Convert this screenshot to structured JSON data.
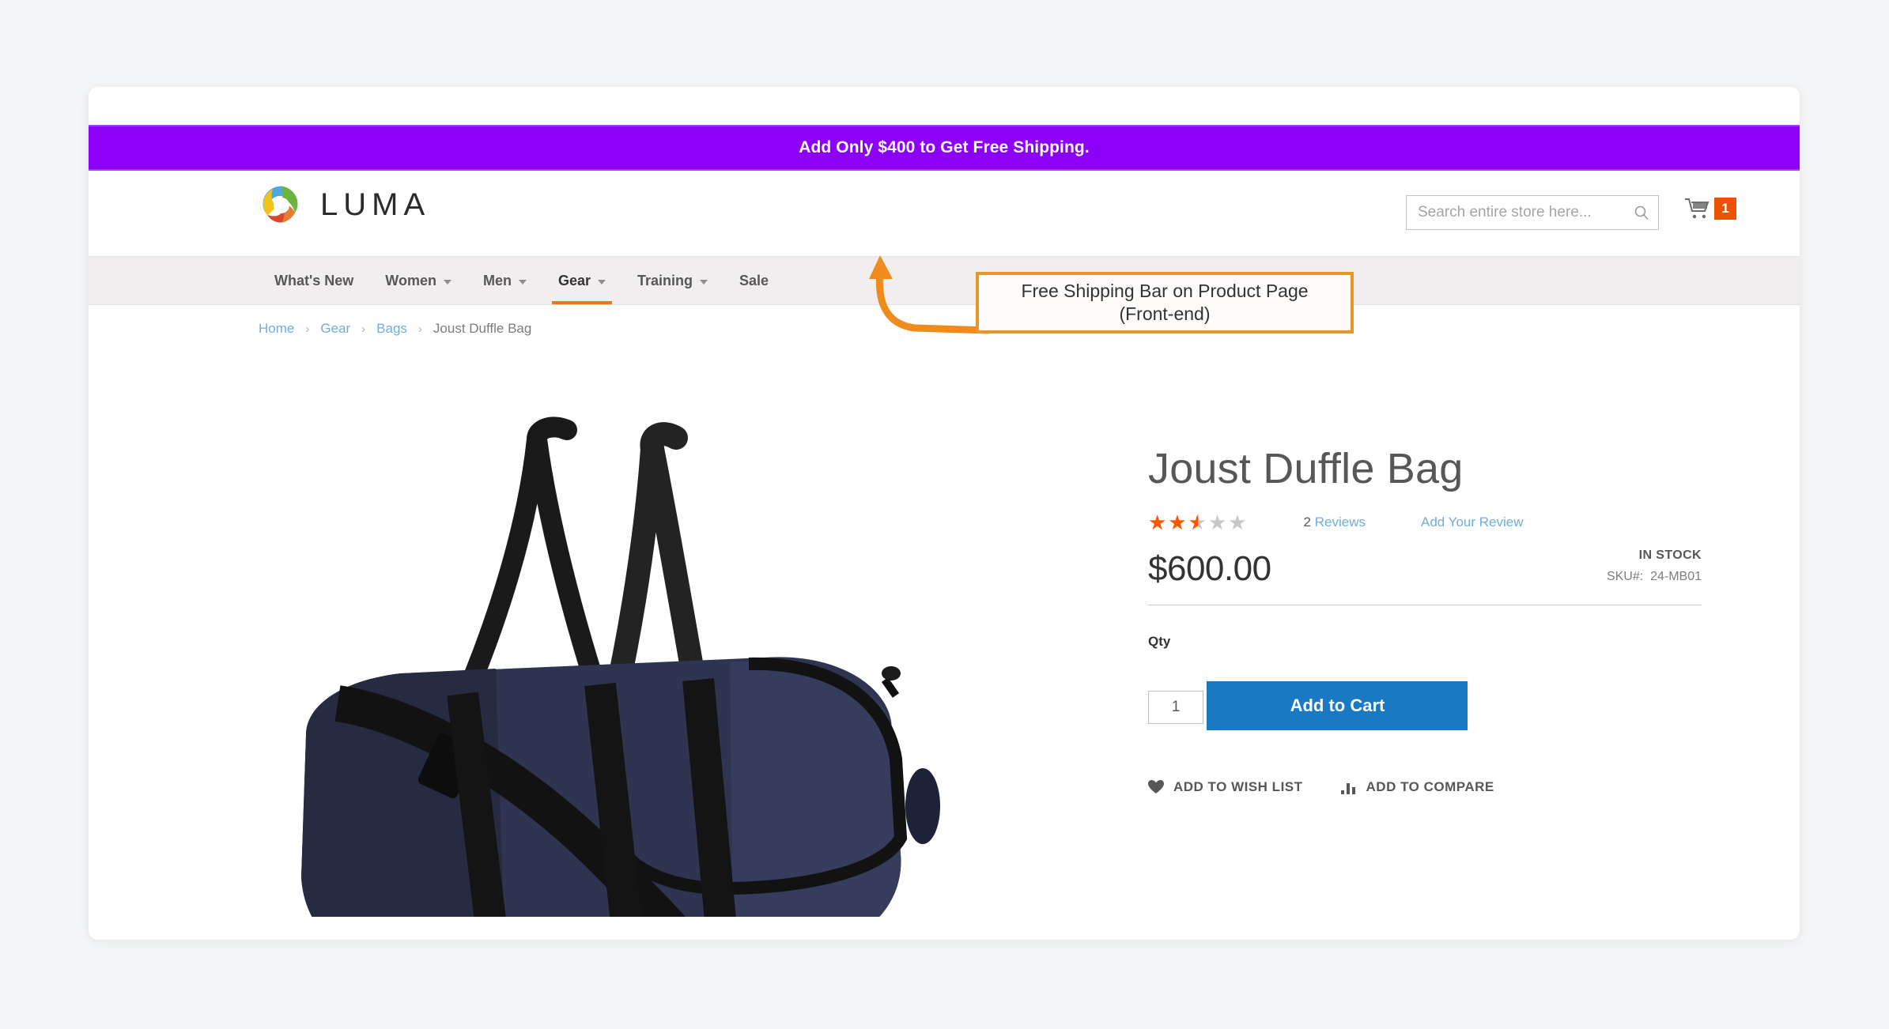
{
  "promo": {
    "message": "Add Only $400 to Get Free Shipping."
  },
  "annotation": {
    "line1": "Free Shipping Bar on Product Page",
    "line2": "(Front-end)",
    "border_color": "#e8962a",
    "arrow_color": "#f08c1e"
  },
  "header": {
    "logo_text": "LUMA",
    "logo_icon": "luma-ring-logo",
    "search": {
      "placeholder": "Search entire store here...",
      "value": "",
      "icon": "search-icon"
    },
    "cart": {
      "icon": "shopping-cart-icon",
      "count": "1",
      "badge_color": "#eb5202"
    }
  },
  "nav": {
    "items": [
      {
        "label": "What's New",
        "has_caret": false,
        "active": false
      },
      {
        "label": "Women",
        "has_caret": true,
        "active": false
      },
      {
        "label": "Men",
        "has_caret": true,
        "active": false
      },
      {
        "label": "Gear",
        "has_caret": true,
        "active": true
      },
      {
        "label": "Training",
        "has_caret": true,
        "active": false
      },
      {
        "label": "Sale",
        "has_caret": false,
        "active": false
      }
    ],
    "active_underline_color": "#e8772e"
  },
  "breadcrumb": {
    "items": [
      {
        "label": "Home",
        "link": true
      },
      {
        "label": "Gear",
        "link": true
      },
      {
        "label": "Bags",
        "link": true
      },
      {
        "label": "Joust Duffle Bag",
        "link": false
      }
    ],
    "separator": "›"
  },
  "product": {
    "title": "Joust Duffle Bag",
    "image_alt": "navy-duffle-bag-photo",
    "rating": {
      "value": 2.5,
      "max": 5,
      "percent": "50%",
      "filled_color": "#ff5501",
      "empty_color": "#c7c7c7",
      "reviews_count": "2",
      "reviews_label": "Reviews",
      "add_review_label": "Add Your Review"
    },
    "price": "$600.00",
    "stock_status": "IN STOCK",
    "sku_label": "SKU#:",
    "sku_value": "24-MB01",
    "qty_label": "Qty",
    "qty_value": "1",
    "add_to_cart_label": "Add to Cart",
    "add_to_cart_color": "#1979c3",
    "wishlist_label": "ADD TO WISH LIST",
    "wishlist_icon": "heart-icon",
    "compare_label": "ADD TO COMPARE",
    "compare_icon": "bar-chart-icon"
  }
}
